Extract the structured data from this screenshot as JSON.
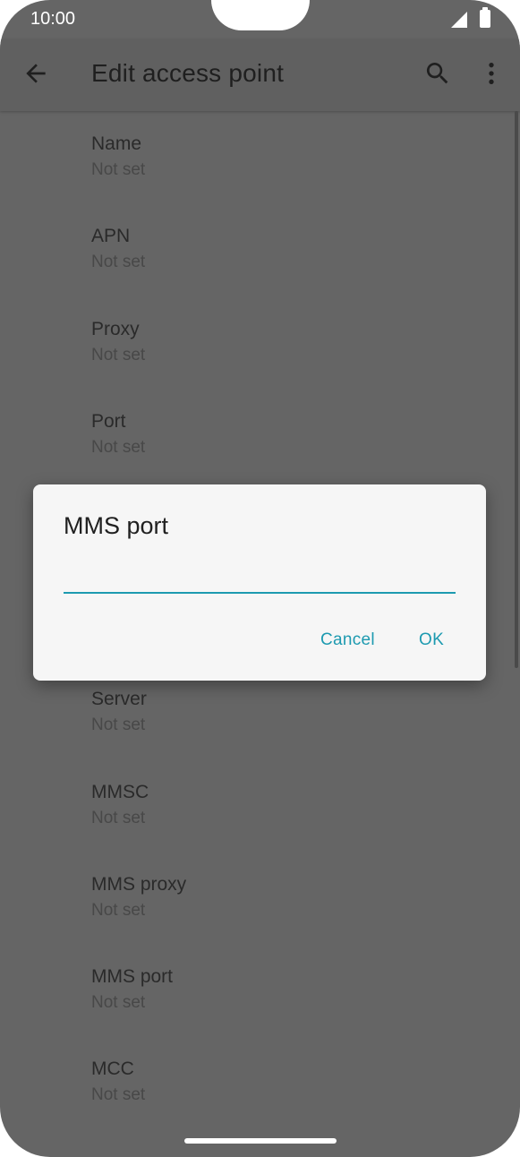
{
  "status_bar": {
    "time": "10:00",
    "signal_icon": "signal-icon",
    "battery_icon": "battery-icon"
  },
  "app_bar": {
    "title": "Edit access point",
    "back_icon": "arrow-back-icon",
    "search_icon": "search-icon",
    "more_icon": "more-vert-icon"
  },
  "list": [
    {
      "title": "Name",
      "value": "Not set"
    },
    {
      "title": "APN",
      "value": "Not set"
    },
    {
      "title": "Proxy",
      "value": "Not set"
    },
    {
      "title": "Port",
      "value": "Not set"
    },
    {
      "title": "Server",
      "value": "Not set"
    },
    {
      "title": "MMSC",
      "value": "Not set"
    },
    {
      "title": "MMS proxy",
      "value": "Not set"
    },
    {
      "title": "MMS port",
      "value": "Not set"
    },
    {
      "title": "MCC",
      "value": "Not set"
    }
  ],
  "dialog": {
    "title": "MMS port",
    "input_value": "",
    "cancel_label": "Cancel",
    "ok_label": "OK"
  },
  "colors": {
    "accent": "#1d9ab0",
    "scrim": "#656565",
    "dialog_bg": "#f6f6f6"
  }
}
